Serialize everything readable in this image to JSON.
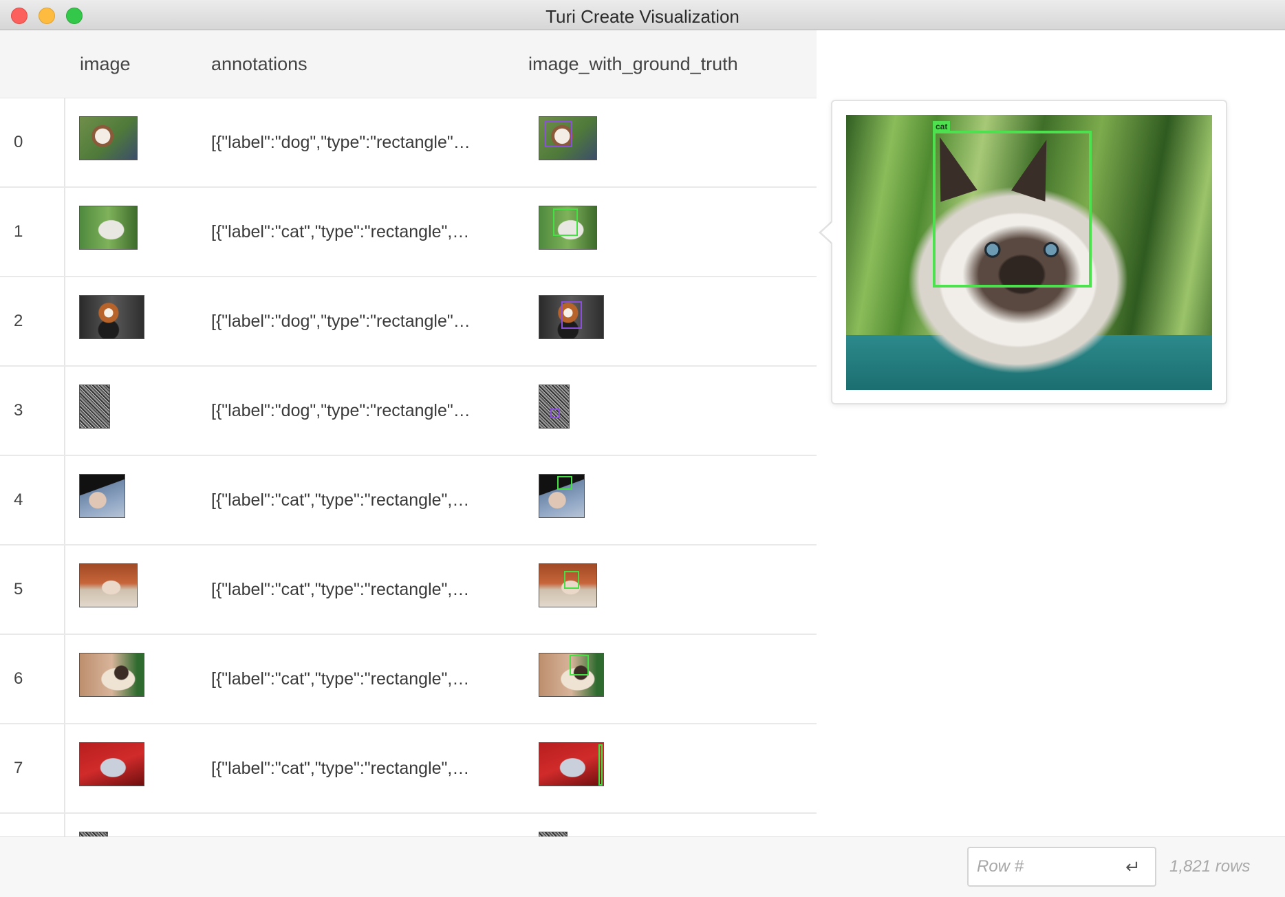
{
  "window": {
    "title": "Turi Create Visualization"
  },
  "table": {
    "columns": [
      "image",
      "annotations",
      "image_with_ground_truth"
    ],
    "rows": [
      {
        "index": "0",
        "annotation": "[{\"label\":\"dog\",\"type\":\"rectangle\"…"
      },
      {
        "index": "1",
        "annotation": "[{\"label\":\"cat\",\"type\":\"rectangle\",…"
      },
      {
        "index": "2",
        "annotation": "[{\"label\":\"dog\",\"type\":\"rectangle\"…"
      },
      {
        "index": "3",
        "annotation": "[{\"label\":\"dog\",\"type\":\"rectangle\"…"
      },
      {
        "index": "4",
        "annotation": "[{\"label\":\"cat\",\"type\":\"rectangle\",…"
      },
      {
        "index": "5",
        "annotation": "[{\"label\":\"cat\",\"type\":\"rectangle\",…"
      },
      {
        "index": "6",
        "annotation": "[{\"label\":\"cat\",\"type\":\"rectangle\",…"
      },
      {
        "index": "7",
        "annotation": "[{\"label\":\"cat\",\"type\":\"rectangle\",…"
      }
    ]
  },
  "preview": {
    "box_label": "cat",
    "box_color": "#4ee04e"
  },
  "footer": {
    "row_input_placeholder": "Row #",
    "enter_icon": "return-key-icon",
    "row_count": "1,821 rows"
  }
}
